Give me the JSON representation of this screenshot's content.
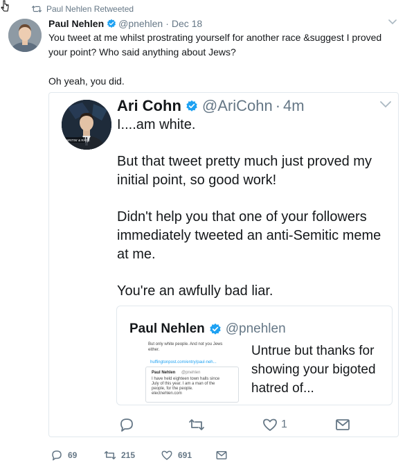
{
  "colors": {
    "accent": "#1da1f2",
    "secondary_text": "#657786",
    "border": "#e1e8ed",
    "text": "#14171a"
  },
  "retweet": {
    "icon": "retweet-icon",
    "label": "Paul Nehlen Retweeted"
  },
  "tweet": {
    "author_name": "Paul Nehlen",
    "handle": "@pnehlen",
    "separator": "·",
    "time": "Dec 18",
    "paragraphs": [
      "You tweet at me whilst prostrating yourself for another race &suggest I proved your point? Who said anything about Jews?",
      "Oh yeah, you did."
    ],
    "actions": {
      "reply_count": "69",
      "retweet_count": "215",
      "like_count": "691"
    }
  },
  "quoted": {
    "author_name": "Ari Cohn",
    "handle": "@AriCohn",
    "separator": "·",
    "time": "4m",
    "avatar_caption": "WRITIN' & RACE",
    "paragraphs": [
      "I....am white.",
      "But that tweet pretty much just proved my initial point, so good work!",
      "Didn't help you that one of your followers immediately tweeted an anti-Semitic meme at me.",
      "You're an awfully bad liar."
    ],
    "actions": {
      "reply_count": "",
      "retweet_count": "",
      "like_count": "1"
    },
    "nested": {
      "author_name": "Paul Nehlen",
      "handle": "@pnehlen",
      "text": "Untrue but thanks for showing your bigoted hatred of...",
      "thumb": {
        "line1": "But only white people. And not you Jews",
        "line2": "either.",
        "link": "huffingtonpost.com/entry/paul-neh...",
        "inner_name": "Paul Nehlen",
        "inner_handle": "@pnehlen",
        "inner_lines": [
          "I have held eighteen town halls since",
          "July of this year. I am a man of the",
          "people, for the people.",
          "electnehlen.com"
        ]
      }
    }
  }
}
